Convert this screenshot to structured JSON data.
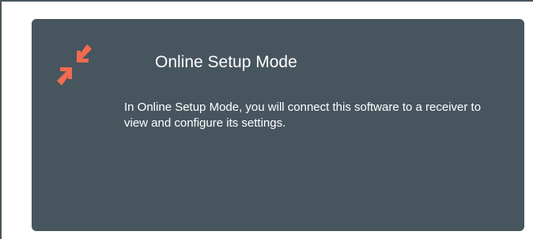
{
  "card": {
    "icon": "compress-arrows-icon",
    "accent_color": "#f26b4f",
    "background_color": "#47555e",
    "title": "Online Setup Mode",
    "description": "In Online Setup Mode, you will connect this software to a receiver to view and configure its settings."
  }
}
